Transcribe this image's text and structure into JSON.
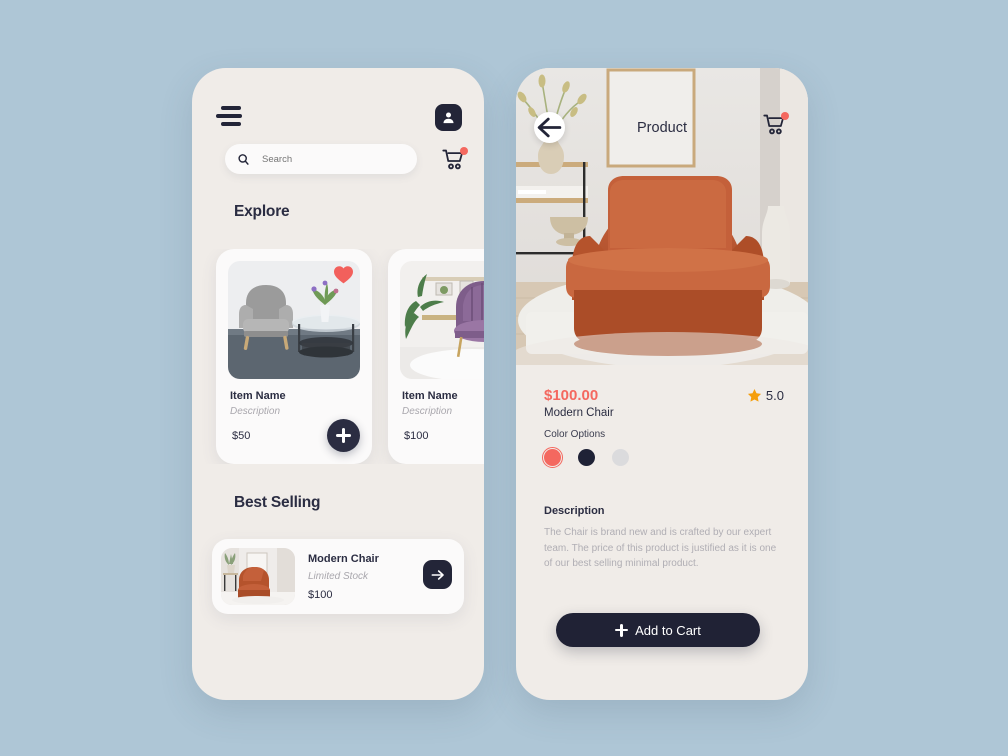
{
  "app": {
    "background_color": "#aec6d6",
    "screen_background": "#f0ece8",
    "accent_color": "#f4685f",
    "dark_color": "#2b2d42",
    "star_color": "#f59e0b"
  },
  "home": {
    "menu_icon": "hamburger-icon",
    "profile_icon": "person-icon",
    "search": {
      "placeholder": "Search",
      "value": "",
      "icon": "search-icon"
    },
    "cart": {
      "icon": "cart-icon",
      "badge": ""
    },
    "explore": {
      "title": "Explore",
      "cards": [
        {
          "name": "Item Name",
          "description": "Description",
          "price": "$50",
          "favorite_icon": "heart-icon",
          "add_label": "+",
          "image": "gray-armchair-with-glass-side-table"
        },
        {
          "name": "Item Name",
          "description": "Description",
          "price": "$100",
          "image": "purple-velvet-shell-chair"
        }
      ]
    },
    "best_selling": {
      "title": "Best Selling",
      "item": {
        "name": "Modern Chair",
        "subtitle": "Limited Stock",
        "price": "$100",
        "arrow_icon": "arrow-right-icon",
        "image": "rust-orange-lounge-chair"
      }
    }
  },
  "detail": {
    "back_icon": "arrow-left-icon",
    "title": "Product",
    "cart": {
      "icon": "cart-icon",
      "badge": ""
    },
    "hero_image": "rust-orange-lounge-chair-in-room",
    "price": "$100.00",
    "name": "Modern Chair",
    "rating": {
      "icon": "star-icon",
      "value": "5.0"
    },
    "color_options": {
      "label": "Color Options",
      "swatches": [
        {
          "name": "coral",
          "hex": "#f4685f",
          "selected": true
        },
        {
          "name": "navy",
          "hex": "#1f2236",
          "selected": false
        },
        {
          "name": "light-gray",
          "hex": "#dbdbdd",
          "selected": false
        }
      ]
    },
    "description": {
      "title": "Description",
      "body": "The Chair is brand new and is crafted by our expert team. The price of this product is justified as it is one of our best selling minimal product."
    },
    "add_to_cart": {
      "label": "Add to Cart",
      "plus_icon": "plus-icon"
    }
  }
}
